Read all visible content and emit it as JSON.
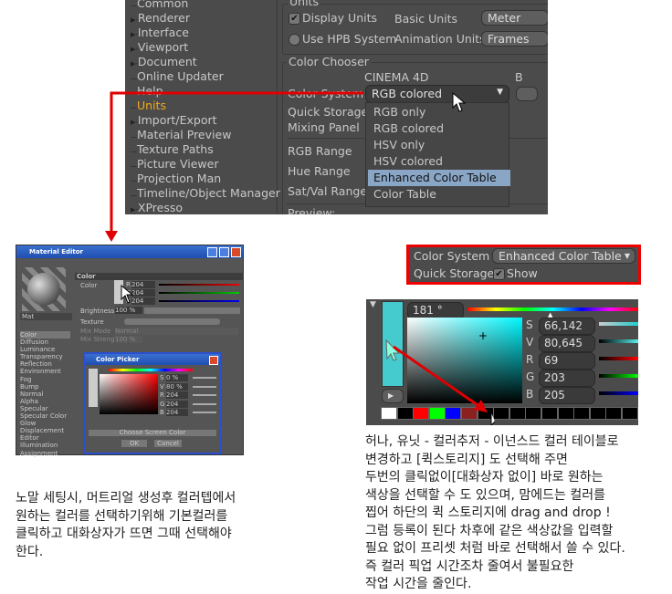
{
  "prefs": {
    "tree": [
      {
        "label": "Common",
        "expandable": false
      },
      {
        "label": "Renderer",
        "expandable": true
      },
      {
        "label": "Interface",
        "expandable": true
      },
      {
        "label": "Viewport",
        "expandable": true
      },
      {
        "label": "Document",
        "expandable": true
      },
      {
        "label": "Online Updater",
        "expandable": false
      },
      {
        "label": "Help",
        "expandable": false
      },
      {
        "label": "Units",
        "expandable": false,
        "selected": true
      },
      {
        "label": "Import/Export",
        "expandable": true
      },
      {
        "label": "Material Preview",
        "expandable": false
      },
      {
        "label": "Texture Paths",
        "expandable": false
      },
      {
        "label": "Picture Viewer",
        "expandable": false
      },
      {
        "label": "Projection Man",
        "expandable": false
      },
      {
        "label": "Timeline/Object Manager",
        "expandable": false
      },
      {
        "label": "XPresso",
        "expandable": true
      }
    ],
    "units": {
      "group": "Units",
      "display_units": "Display Units",
      "display_units_checked": true,
      "basic_units": "Basic Units",
      "basic_units_value": "Meter",
      "use_hpb": "Use HPB System",
      "use_hpb_checked": false,
      "animation_units": "Animation Units",
      "animation_units_value": "Frames"
    },
    "color_chooser": {
      "group": "Color Chooser",
      "column_header": "CINEMA 4D",
      "column_header2": "B",
      "color_system": "Color System",
      "color_system_value": "RGB colored",
      "quick_storage": "Quick Storage",
      "mixing_panel": "Mixing Panel",
      "rgb_range": "RGB Range",
      "hue_range": "Hue Range",
      "satval_range": "Sat/Val Range",
      "preview": "Preview:",
      "options": [
        "RGB only",
        "RGB colored",
        "HSV only",
        "HSV colored",
        "Enhanced Color Table",
        "Color Table"
      ],
      "highlighted": "Enhanced Color Table"
    }
  },
  "material_editor": {
    "title": "Material Editor",
    "mat_name": "Mat",
    "section": "Color",
    "color_label": "Color",
    "rgb": [
      "204",
      "204",
      "204"
    ],
    "channels_rgb": [
      "R",
      "G",
      "B"
    ],
    "brightness": "Brightness",
    "brightness_value": "100 %",
    "texture": "Texture",
    "mix_mode": "Mix Mode",
    "mix_mode_value": "Normal",
    "mix_strength": "Mix Strength",
    "mix_strength_value": "100 %",
    "channels": [
      "Color",
      "Diffusion",
      "Luminance",
      "Transparency",
      "Reflection",
      "Environment",
      "Fog",
      "Bump",
      "Normal",
      "Alpha",
      "Specular",
      "Specular Color",
      "Glow",
      "Displacement",
      "Editor",
      "Illumination",
      "Assignment"
    ],
    "picker": {
      "title": "Color Picker",
      "s": "0 %",
      "v": "80 %",
      "r": "204",
      "g": "204",
      "b": "204",
      "labels": [
        "S",
        "V",
        "R",
        "G",
        "B"
      ],
      "choose_screen": "Choose Screen Color",
      "ok": "OK",
      "cancel": "Cancel"
    }
  },
  "color_system_box": {
    "label": "Color System",
    "value": "Enhanced Color Table",
    "quick_storage": "Quick Storage",
    "show": "Show",
    "show_checked": true
  },
  "color_picker": {
    "hue": "181 °",
    "labels": [
      "S",
      "V",
      "R",
      "G",
      "B"
    ],
    "values": [
      "66,142 %",
      "80,645 %",
      "69",
      "203",
      "205"
    ],
    "current_color": "#45cbcd",
    "swatches": [
      "#ffffff",
      "#000000",
      "#ff0000",
      "#00ff00",
      "#0000ff",
      "#8b2020",
      "#000000",
      "#000000",
      "#000000",
      "#000000",
      "#000000",
      "#000000",
      "#000000",
      "#000000",
      "#000000",
      "#000000"
    ]
  },
  "captions": {
    "left": [
      "노말 세팅시, 머트리얼 생성후 컬러텝에서",
      "원하는 컬러를 선택하기위해 기본컬러를",
      "클릭하고 대화상자가 뜨면 그때 선택해야",
      "한다."
    ],
    "right": [
      "허나, 유닛 - 컬러추저 - 이넌스드 컬러 테이블로",
      "변경하고 [퀵스토리지] 도 선택해 주면",
      "두번의 클릭없이[대화상자 없이] 바로 원하는",
      "색상을 선택할 수 도 있으며, 맘에드는 컬러를",
      "찝어 하단의 퀵 스토리지에 drag and drop !",
      "그럼 등록이 된다 차후에 같은 색상값을 입력할",
      "필요 없이 프리셋 처럼 바로 선택해서 쓸 수 있다.",
      "즉 컬러 픽업 시간조차 줄여서 불필요한",
      "작업 시간을 줄인다."
    ]
  },
  "accent": "#e00000"
}
